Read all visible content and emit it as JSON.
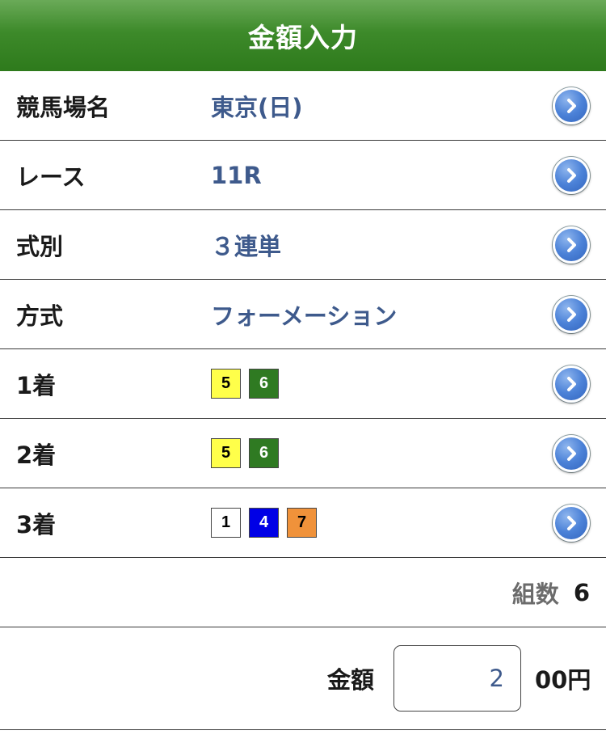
{
  "header": {
    "title": "金額入力"
  },
  "rows": [
    {
      "label": "競馬場名",
      "value": "東京(日)"
    },
    {
      "label": "レース",
      "value": "11R"
    },
    {
      "label": "式別",
      "value": "３連単"
    },
    {
      "label": "方式",
      "value": "フォーメーション"
    }
  ],
  "positions": [
    {
      "label": "1着",
      "horses": [
        {
          "num": "5",
          "color": "#ffff4a",
          "text_color": "#000000"
        },
        {
          "num": "6",
          "color": "#2f7a22",
          "text_color": "#ffffff"
        }
      ]
    },
    {
      "label": "2着",
      "horses": [
        {
          "num": "5",
          "color": "#ffff4a",
          "text_color": "#000000"
        },
        {
          "num": "6",
          "color": "#2f7a22",
          "text_color": "#ffffff"
        }
      ]
    },
    {
      "label": "3着",
      "horses": [
        {
          "num": "1",
          "color": "#ffffff",
          "text_color": "#000000"
        },
        {
          "num": "4",
          "color": "#0000e6",
          "text_color": "#ffffff"
        },
        {
          "num": "7",
          "color": "#f0923a",
          "text_color": "#000000"
        }
      ]
    }
  ],
  "combinations": {
    "label": "組数",
    "value": "6"
  },
  "amount": {
    "label": "金額",
    "value": "2",
    "unit": "00円"
  },
  "icons": {
    "row_action": "chevron-right-circle-icon"
  }
}
